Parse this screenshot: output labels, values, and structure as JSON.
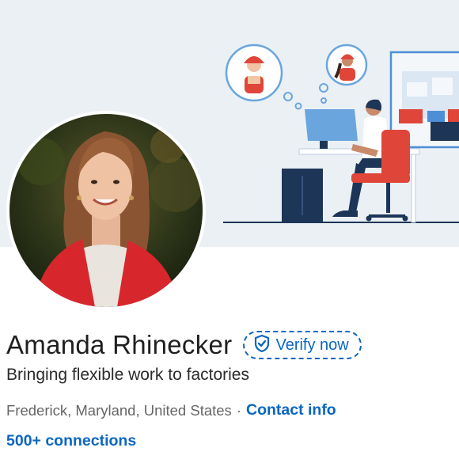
{
  "profile": {
    "name": "Amanda Rhinecker",
    "verify_label": "Verify now",
    "headline": "Bringing flexible work to factories",
    "location": "Frederick, Maryland, United States",
    "separator": "·",
    "contact_info": "Contact info",
    "connections": "500+ connections"
  },
  "colors": {
    "link_blue": "#0a66c2",
    "banner_bg": "#eaf0f4",
    "illustration_red": "#e0453a",
    "illustration_navy": "#1d3557"
  },
  "icons": {
    "verify": "shield-check-icon"
  }
}
